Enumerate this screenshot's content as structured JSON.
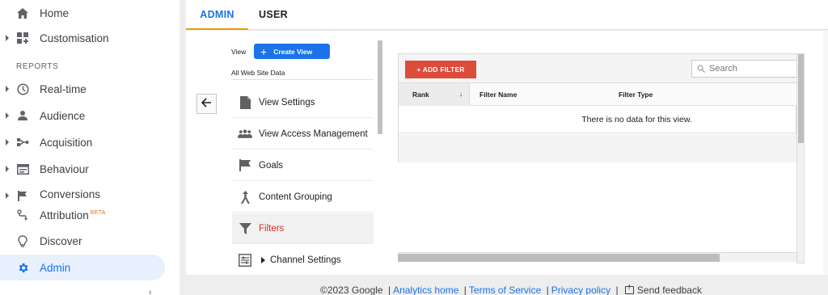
{
  "sidebar": {
    "items_top": [
      {
        "label": "Home",
        "icon": "home-icon"
      },
      {
        "label": "Customisation",
        "icon": "dashboard-icon"
      }
    ],
    "section_title": "REPORTS",
    "items_reports": [
      {
        "label": "Real-time",
        "icon": "clock-icon"
      },
      {
        "label": "Audience",
        "icon": "person-icon"
      },
      {
        "label": "Acquisition",
        "icon": "acquisition-icon"
      },
      {
        "label": "Behaviour",
        "icon": "behaviour-icon"
      },
      {
        "label": "Conversions",
        "icon": "flag-icon"
      }
    ],
    "items_bottom": [
      {
        "label": "Attribution",
        "badge": "BETA",
        "icon": "attribution-icon"
      },
      {
        "label": "Discover",
        "icon": "lightbulb-icon"
      },
      {
        "label": "Admin",
        "icon": "gear-icon"
      }
    ],
    "collapse_icon": "‹"
  },
  "tabs": [
    {
      "label": "ADMIN",
      "active": true
    },
    {
      "label": "USER",
      "active": false
    }
  ],
  "view_panel": {
    "view_label": "View",
    "create_view_label": "Create View",
    "view_name": "All Web Site Data",
    "menu": [
      {
        "label": "View Settings",
        "icon": "document-icon"
      },
      {
        "label": "View Access Management",
        "icon": "people-icon"
      },
      {
        "label": "Goals",
        "icon": "flag-icon"
      },
      {
        "label": "Content Grouping",
        "icon": "grouping-icon"
      },
      {
        "label": "Filters",
        "icon": "filter-icon",
        "active": true
      },
      {
        "label": "Channel Settings",
        "icon": "channel-icon"
      }
    ]
  },
  "filters_table": {
    "add_filter_label": "+ ADD FILTER",
    "search_placeholder": "Search",
    "columns": [
      "Rank",
      "Filter Name",
      "Filter Type"
    ],
    "sort_indicator": "↓",
    "empty_message": "There is no data for this view."
  },
  "footer": {
    "copyright": "©2023 Google",
    "links": [
      "Analytics home",
      "Terms of Service",
      "Privacy policy"
    ],
    "feedback": "Send feedback",
    "separator": "|"
  },
  "colors": {
    "accent_blue": "#1a73e8",
    "active_tab_underline": "#f29900",
    "add_filter_red": "#dd4b39",
    "active_menu_text": "#d93025"
  }
}
